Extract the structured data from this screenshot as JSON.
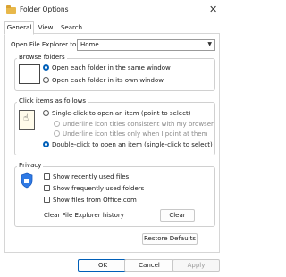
{
  "window": {
    "title": "Folder Options"
  },
  "tabs": [
    {
      "label": "General"
    },
    {
      "label": "View"
    },
    {
      "label": "Search"
    }
  ],
  "open_explorer": {
    "label": "Open File Explorer to:",
    "value": "Home"
  },
  "browse_folders": {
    "title": "Browse folders",
    "options": [
      {
        "label": "Open each folder in the same window"
      },
      {
        "label": "Open each folder in its own window"
      }
    ]
  },
  "click_items": {
    "title": "Click items as follows",
    "single_click": "Single-click to open an item (point to select)",
    "underline_consistent": "Underline icon titles consistent with my browser",
    "underline_point": "Underline icon titles only when I point at them",
    "double_click": "Double-click to open an item (single-click to select)"
  },
  "privacy": {
    "title": "Privacy",
    "checks": [
      {
        "label": "Show recently used files"
      },
      {
        "label": "Show frequently used folders"
      },
      {
        "label": "Show files from Office.com"
      }
    ],
    "clear_label": "Clear File Explorer history",
    "clear_button": "Clear"
  },
  "restore_defaults": "Restore Defaults",
  "footer": {
    "ok": "OK",
    "cancel": "Cancel",
    "apply": "Apply"
  },
  "colors": {
    "accent": "#005fb8",
    "folder": "#e8b84a"
  }
}
